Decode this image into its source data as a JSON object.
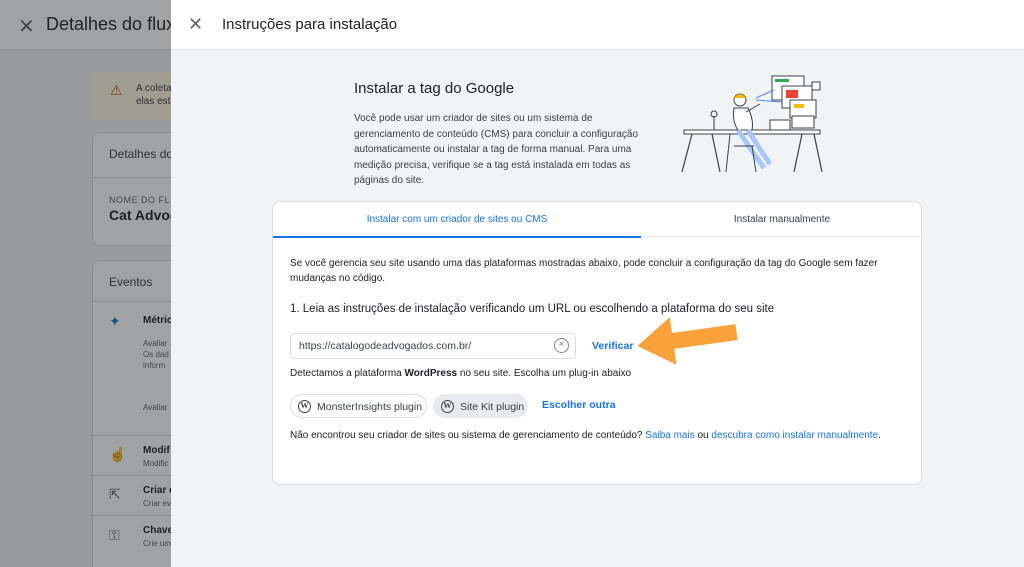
{
  "background": {
    "title": "Detalhes do fluxo",
    "warning_text_line1": "A coleta",
    "warning_text_line2": "elas est",
    "card1_heading": "Detalhes do",
    "stream_name_label": "NOME DO FL",
    "stream_name_value": "Cat Advog",
    "card2_heading": "Eventos",
    "rows": [
      {
        "title": "Métric",
        "sub1": "Avaliar",
        "sub2": "Os dad",
        "sub3": "inform"
      },
      {
        "title": "",
        "sub1": "Avaliar"
      },
      {
        "title": "Modif",
        "sub1": "Modific"
      },
      {
        "title": "Criar e",
        "sub1": "Criar ev"
      },
      {
        "title": "Chave",
        "sub1": "Crie um"
      }
    ]
  },
  "dialog": {
    "title": "Instruções para instalação",
    "intro": {
      "title": "Instalar a tag do Google",
      "text": "Você pode usar um criador de sites ou um sistema de gerenciamento de conteúdo (CMS) para concluir a configuração automaticamente ou instalar a tag de forma manual. Para uma medição precisa, verifique se a tag está instalada em todas as páginas do site."
    },
    "tabs": [
      {
        "label": "Instalar com um criador de sites ou CMS",
        "active": true
      },
      {
        "label": "Instalar manualmente",
        "active": false
      }
    ],
    "description": "Se você gerencia seu site usando uma das plataformas mostradas abaixo, pode concluir a configuração da tag do Google sem fazer mudanças no código.",
    "step1": "1. Leia as instruções de instalação verificando um URL ou escolhendo a plataforma do seu site",
    "url_value": "https://catalogodeadvogados.com.br/",
    "verify_label": "Verificar",
    "detected_prefix": "Detectamos a plataforma ",
    "detected_platform": "WordPress",
    "detected_suffix": " no seu site. Escolha um plug-in abaixo",
    "chips": [
      {
        "label": "MonsterInsights plugin",
        "selected": false
      },
      {
        "label": "Site Kit plugin",
        "selected": true
      }
    ],
    "choose_other": "Escolher outra",
    "footer_prefix": "Não encontrou seu criador de sites ou sistema de gerenciamento de conteúdo? ",
    "footer_link1": "Saiba mais",
    "footer_mid": " ou ",
    "footer_link2": "descubra como instalar manualmente",
    "footer_suffix": "."
  },
  "colors": {
    "accent": "#1a73e8",
    "annotation_arrow": "#f9a23b"
  },
  "icons": {
    "close": "close-icon",
    "warning": "warning-icon",
    "clear": "clear-circle-icon",
    "wordpress": "wordpress-icon",
    "arrow": "annotation-arrow"
  }
}
